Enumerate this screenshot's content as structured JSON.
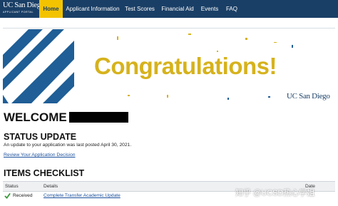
{
  "header": {
    "logo_line1": "UC San Diego",
    "logo_line2": "APPLICANT PORTAL",
    "nav": [
      {
        "label": "Home",
        "active": true
      },
      {
        "label": "Applicant Information",
        "active": false
      },
      {
        "label": "Test Scores",
        "active": false
      },
      {
        "label": "Financial Aid",
        "active": false
      },
      {
        "label": "Events",
        "active": false
      },
      {
        "label": "FAQ",
        "active": false
      }
    ]
  },
  "banner": {
    "title": "Congratulations!",
    "logo_text": "UC San Diego"
  },
  "welcome": {
    "heading": "WELCOME"
  },
  "status_update": {
    "heading": "STATUS UPDATE",
    "text": "An update to your application was last posted April 30, 2021.",
    "link": "Review Your Application Decision"
  },
  "checklist": {
    "heading": "ITEMS CHECKLIST",
    "columns": [
      "Status",
      "Details",
      "Date"
    ],
    "rows": [
      {
        "status": "Received",
        "details": "Complete Transfer Academic Update"
      }
    ]
  },
  "watermark": "知乎 @UCSD热心学姐",
  "colors": {
    "nav_bg": "#1a3f66",
    "nav_active": "#f3c300",
    "gold": "#d6b21c",
    "link": "#1a4f9c",
    "check_green": "#3a9a3a"
  }
}
